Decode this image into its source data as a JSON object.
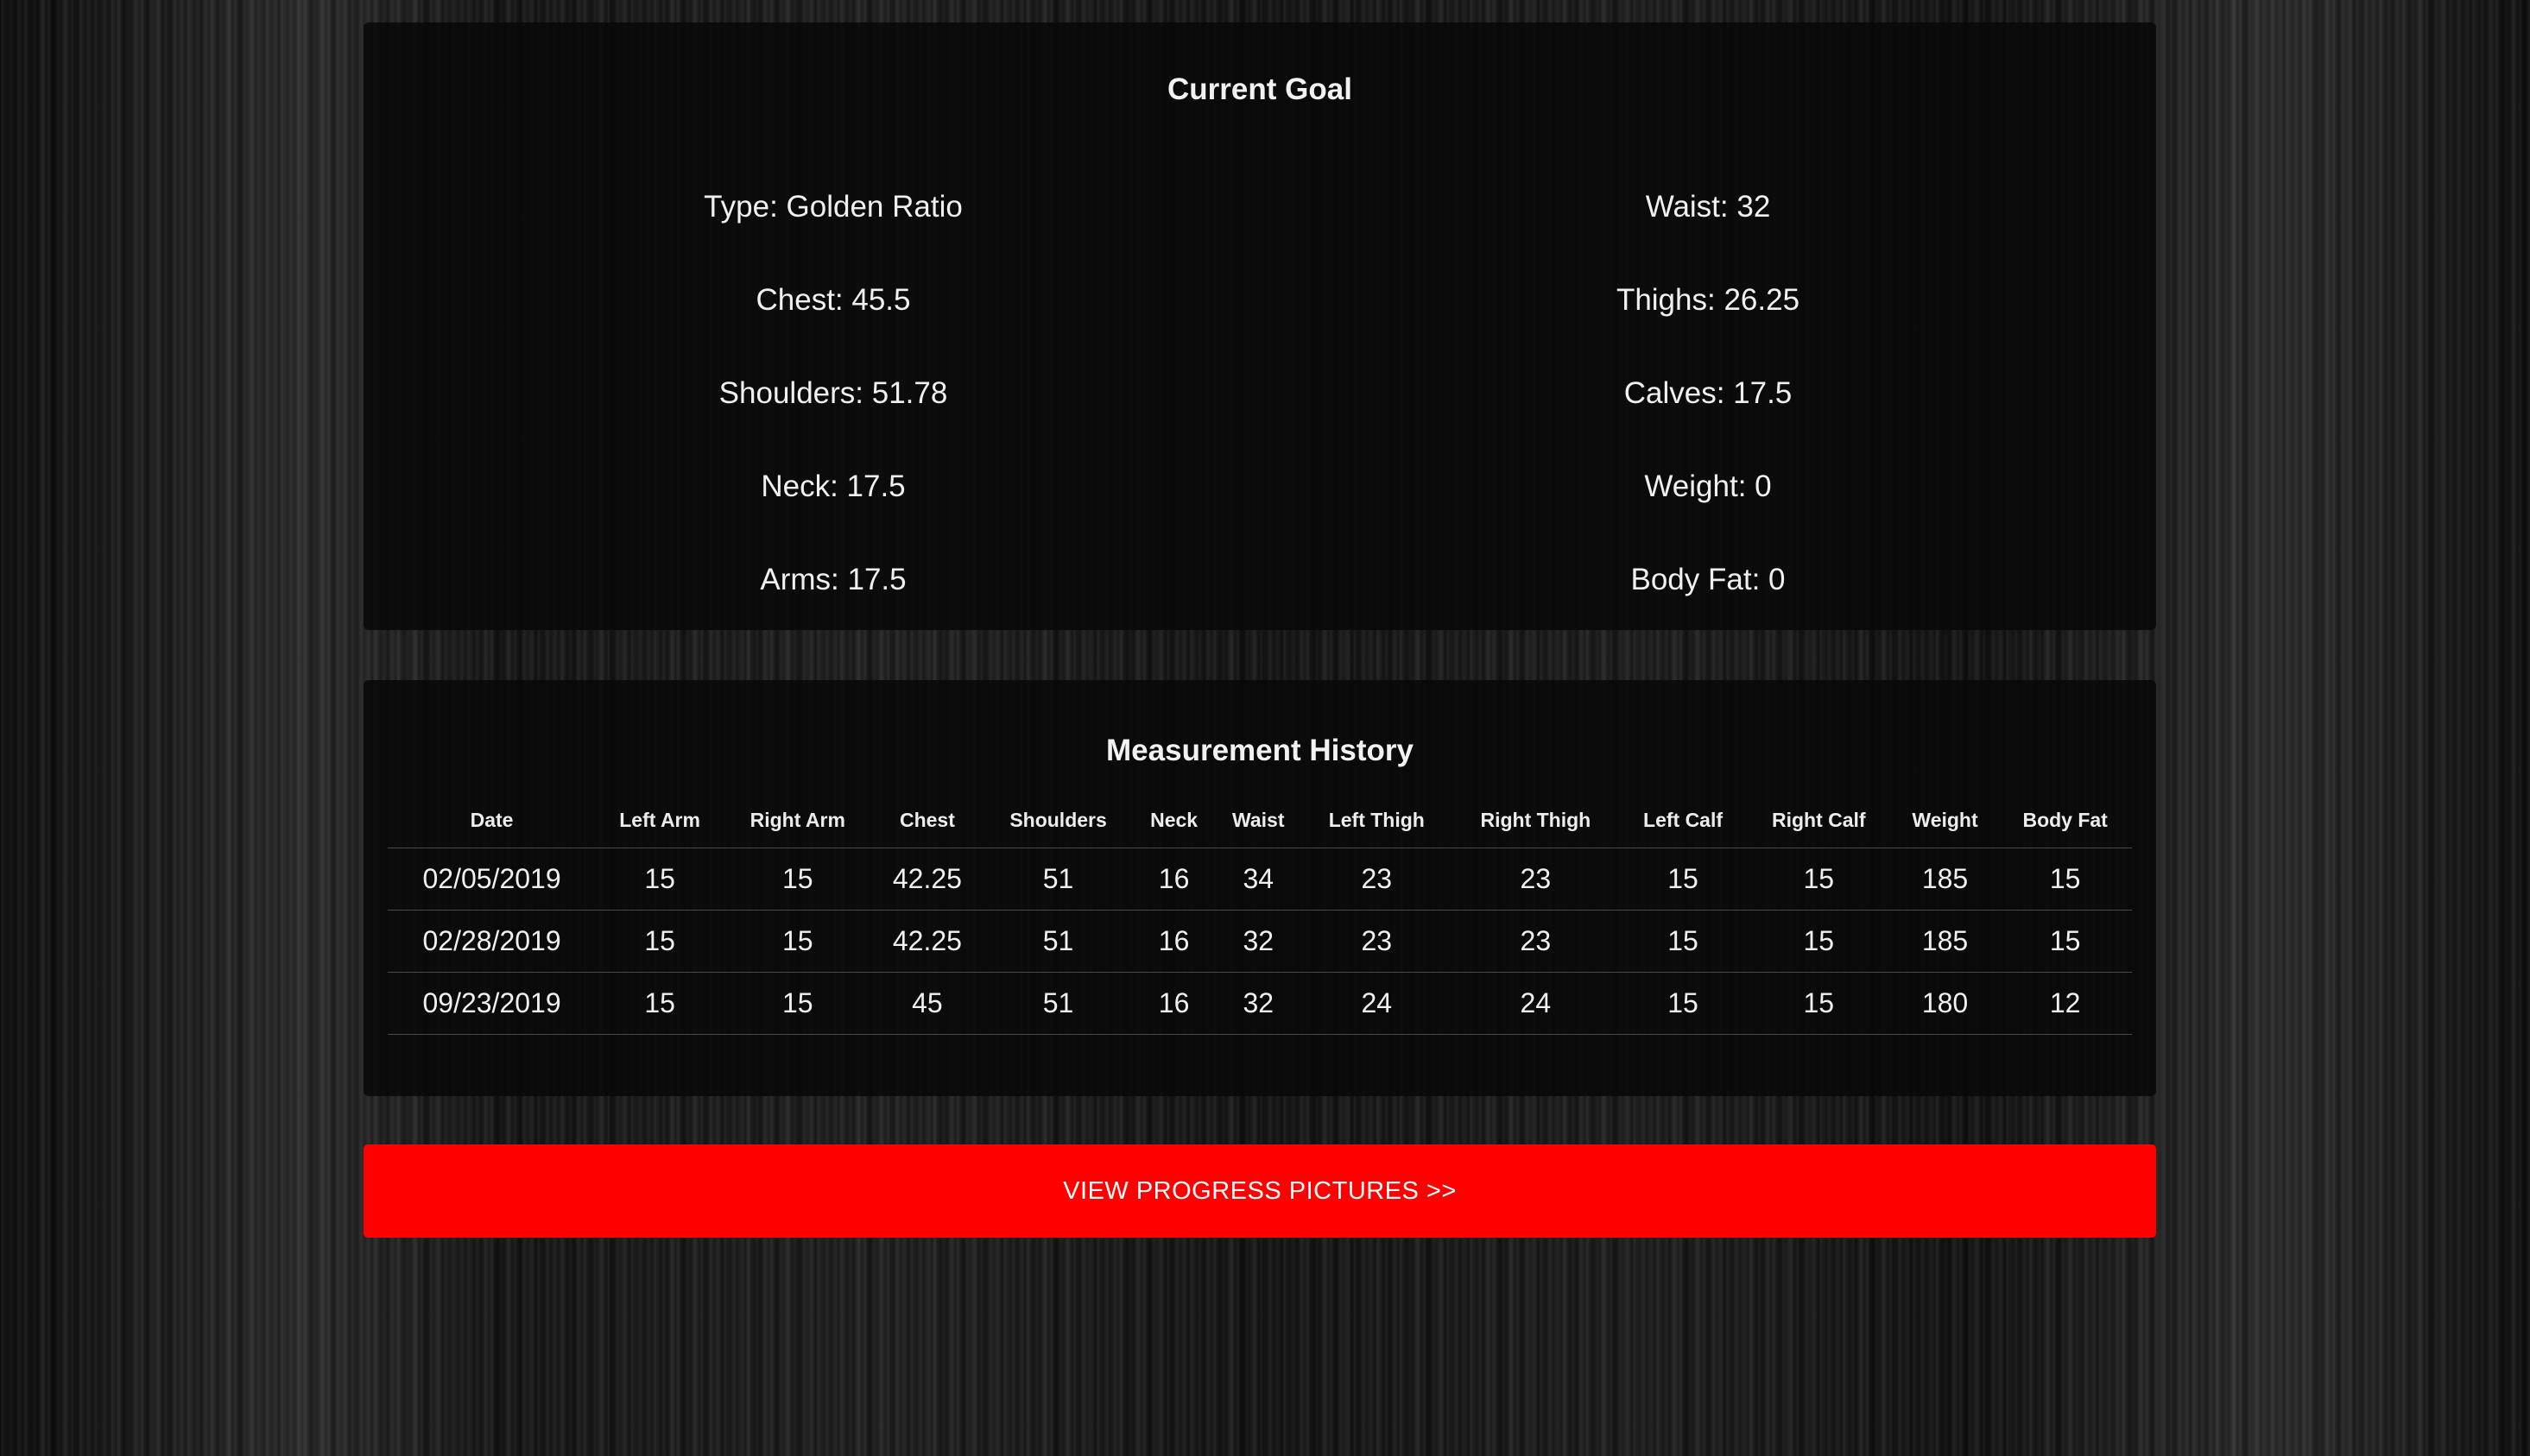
{
  "goal": {
    "title": "Current Goal",
    "left": [
      {
        "label": "Type",
        "value": "Golden Ratio"
      },
      {
        "label": "Chest",
        "value": "45.5"
      },
      {
        "label": "Shoulders",
        "value": "51.78"
      },
      {
        "label": "Neck",
        "value": "17.5"
      },
      {
        "label": "Arms",
        "value": "17.5"
      }
    ],
    "right": [
      {
        "label": "Waist",
        "value": "32"
      },
      {
        "label": "Thighs",
        "value": "26.25"
      },
      {
        "label": "Calves",
        "value": "17.5"
      },
      {
        "label": "Weight",
        "value": "0"
      },
      {
        "label": "Body Fat",
        "value": "0"
      }
    ]
  },
  "history": {
    "title": "Measurement History",
    "columns": [
      "Date",
      "Left Arm",
      "Right Arm",
      "Chest",
      "Shoulders",
      "Neck",
      "Waist",
      "Left Thigh",
      "Right Thigh",
      "Left Calf",
      "Right Calf",
      "Weight",
      "Body Fat"
    ],
    "rows": [
      [
        "02/05/2019",
        "15",
        "15",
        "42.25",
        "51",
        "16",
        "34",
        "23",
        "23",
        "15",
        "15",
        "185",
        "15"
      ],
      [
        "02/28/2019",
        "15",
        "15",
        "42.25",
        "51",
        "16",
        "32",
        "23",
        "23",
        "15",
        "15",
        "185",
        "15"
      ],
      [
        "09/23/2019",
        "15",
        "15",
        "45",
        "51",
        "16",
        "32",
        "24",
        "24",
        "15",
        "15",
        "180",
        "12"
      ]
    ]
  },
  "actions": {
    "progress_label": "VIEW PROGRESS PICTURES >>"
  },
  "colors": {
    "accent": "#ff0000",
    "panel": "#080808",
    "text": "#f0f0f0"
  }
}
